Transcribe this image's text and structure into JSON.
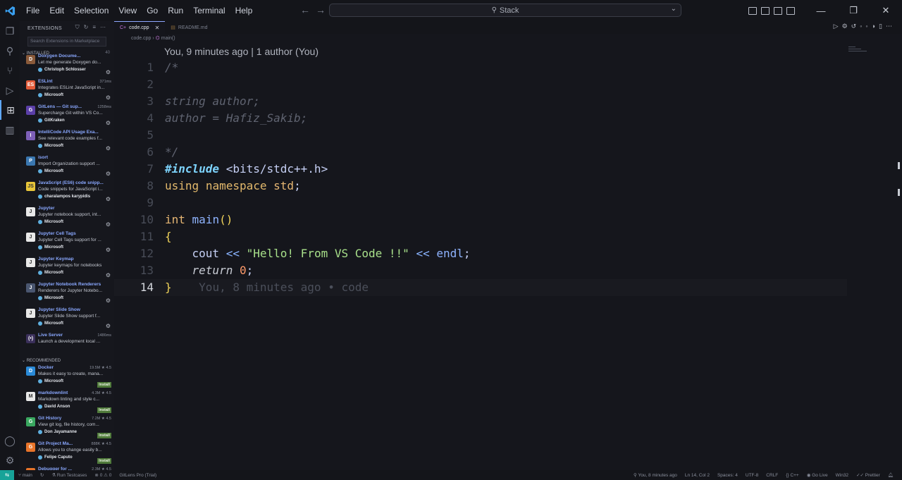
{
  "titlebar": {
    "menu": [
      "File",
      "Edit",
      "Selection",
      "View",
      "Go",
      "Run",
      "Terminal",
      "Help"
    ],
    "command_center": "Stack"
  },
  "sidebar": {
    "title": "EXTENSIONS",
    "search_placeholder": "Search Extensions in Marketplace",
    "installed_label": "INSTALLED",
    "installed_count": "40",
    "installed": [
      {
        "name": "Doxygen Docume...",
        "meta": "",
        "desc": "Let me generate Doxygen do...",
        "publisher": "Christoph Schlosser",
        "icon_color": "#8a5a3a",
        "icon_char": "D"
      },
      {
        "name": "ESLint",
        "meta": "371ms",
        "desc": "Integrates ESLint JavaScript in...",
        "publisher": "Microsoft",
        "icon_color": "#e25b3a",
        "icon_char": "ES"
      },
      {
        "name": "GitLens — Git sup...",
        "meta": "1258ms",
        "desc": "Supercharge Git within VS Co...",
        "publisher": "GitKraken",
        "icon_color": "#5b3fa8",
        "icon_char": "G"
      },
      {
        "name": "IntelliCode API Usage Exa...",
        "meta": "",
        "desc": "See relevant code examples f...",
        "publisher": "Microsoft",
        "icon_color": "#7d5fb8",
        "icon_char": "I"
      },
      {
        "name": "isort",
        "meta": "",
        "desc": "Import Organization support ...",
        "publisher": "Microsoft",
        "icon_color": "#3a77b0",
        "icon_char": "P"
      },
      {
        "name": "JavaScript (ES6) code snipp...",
        "meta": "",
        "desc": "Code snippets for JavaScript i...",
        "publisher": "charalampos karypidis",
        "icon_color": "#e8c63a",
        "icon_char": "JS"
      },
      {
        "name": "Jupyter",
        "meta": "",
        "desc": "Jupyter notebook support, int...",
        "publisher": "Microsoft",
        "icon_color": "#e8e8e8",
        "icon_char": "J"
      },
      {
        "name": "Jupyter Cell Tags",
        "meta": "",
        "desc": "Jupyter Cell Tags support for ...",
        "publisher": "Microsoft",
        "icon_color": "#e8e8e8",
        "icon_char": "J"
      },
      {
        "name": "Jupyter Keymap",
        "meta": "",
        "desc": "Jupyter keymaps for notebooks",
        "publisher": "Microsoft",
        "icon_color": "#e8e8e8",
        "icon_char": "J"
      },
      {
        "name": "Jupyter Notebook Renderers",
        "meta": "",
        "desc": "Renderers for Jupyter Notebo...",
        "publisher": "Microsoft",
        "icon_color": "#4a5670",
        "icon_char": "J"
      },
      {
        "name": "Jupyter Slide Show",
        "meta": "",
        "desc": "Jupyter Slide Show support f...",
        "publisher": "Microsoft",
        "icon_color": "#e8e8e8",
        "icon_char": "J"
      },
      {
        "name": "Live Server",
        "meta": "1486ms",
        "desc": "Launch a development local ...",
        "publisher": "",
        "icon_color": "#3a2f5a",
        "icon_char": "(•)"
      }
    ],
    "recommended_label": "RECOMMENDED",
    "recommended": [
      {
        "name": "Docker",
        "meta": "19.5M ★ 4.5",
        "desc": "Makes it easy to create, mana...",
        "publisher": "Microsoft",
        "icon_color": "#2a8ad8",
        "icon_char": "D"
      },
      {
        "name": "markdownlint",
        "meta": "4.3M ★ 4.5",
        "desc": "Markdown linting and style c...",
        "publisher": "David Anson",
        "icon_color": "#e8e8e8",
        "icon_char": "M"
      },
      {
        "name": "Git History",
        "meta": "7.2M ★ 4.5",
        "desc": "View git log, file history, com...",
        "publisher": "Don Jayamanne",
        "icon_color": "#3aa860",
        "icon_char": "G"
      },
      {
        "name": "Git Project Ma...",
        "meta": "888K ★ 4.5",
        "desc": "Allows you to change easily b...",
        "publisher": "Felipe Caputo",
        "icon_color": "#e8742a",
        "icon_char": "G"
      },
      {
        "name": "Debugger for ...",
        "meta": "2.3M ★ 4.5",
        "desc": "",
        "publisher": "",
        "icon_color": "#e8742a",
        "icon_char": "F"
      }
    ],
    "install_label": "Install"
  },
  "editor": {
    "tabs": [
      {
        "label": "code.cpp",
        "active": true
      },
      {
        "label": "README.md",
        "active": false
      }
    ],
    "breadcrumb": [
      "code.cpp",
      "main()"
    ],
    "blame_header": "You, 9 minutes ago | 1 author (You)",
    "inline_blame": "You, 8 minutes ago • code",
    "current_line": 14
  },
  "statusbar": {
    "branch": "main",
    "run_testcases": "Run Testcases",
    "problems": "0 ⚠ 0",
    "gitlens": "GitLens Pro (Trial)",
    "blame": "You, 8 minutes ago",
    "position": "Ln 14, Col 2",
    "spaces": "Spaces: 4",
    "encoding": "UTF-8",
    "eol": "CRLF",
    "language": "C++",
    "golive": "Go Live",
    "platform": "Win32",
    "prettier": "Prettier"
  }
}
